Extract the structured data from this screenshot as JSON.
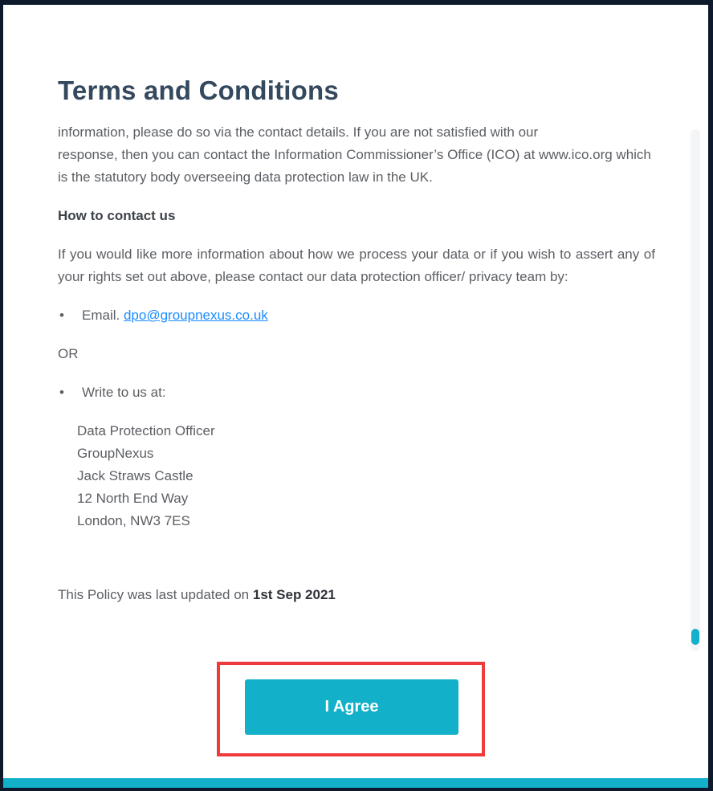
{
  "modal": {
    "title": "Terms and Conditions"
  },
  "content": {
    "cut_line": "information, please do so via the contact details. If you are not satisfied with our",
    "intro_rest": "response, then you can contact the Information Commissioner’s Office (ICO) at www.ico.org which is the statutory body overseeing data protection law in the UK.",
    "contact_heading": "How to contact us",
    "contact_text": "If you would like more information about how we process your data or if you wish to assert any of your rights set out above, please contact our data protection officer/ privacy team by:",
    "bullet_char": "•",
    "email_label": "Email.",
    "email_address": "dpo@groupnexus.co.uk",
    "or_text": "OR",
    "write_label": "Write to us at:",
    "address": {
      "line1": "Data Protection Officer",
      "line2": "GroupNexus",
      "line3": "Jack Straws Castle",
      "line4": "12 North End Way",
      "line5": "London, NW3 7ES"
    },
    "updated_prefix": "This Policy was last updated on",
    "updated_date": "1st Sep 2021"
  },
  "actions": {
    "agree_label": "I Agree"
  },
  "colors": {
    "accent": "#12b0c9",
    "title": "#34495e",
    "body_text": "#5b5e63",
    "link": "#1a8cff",
    "highlight": "#ef3b3b",
    "backdrop": "#0d1a2b"
  }
}
